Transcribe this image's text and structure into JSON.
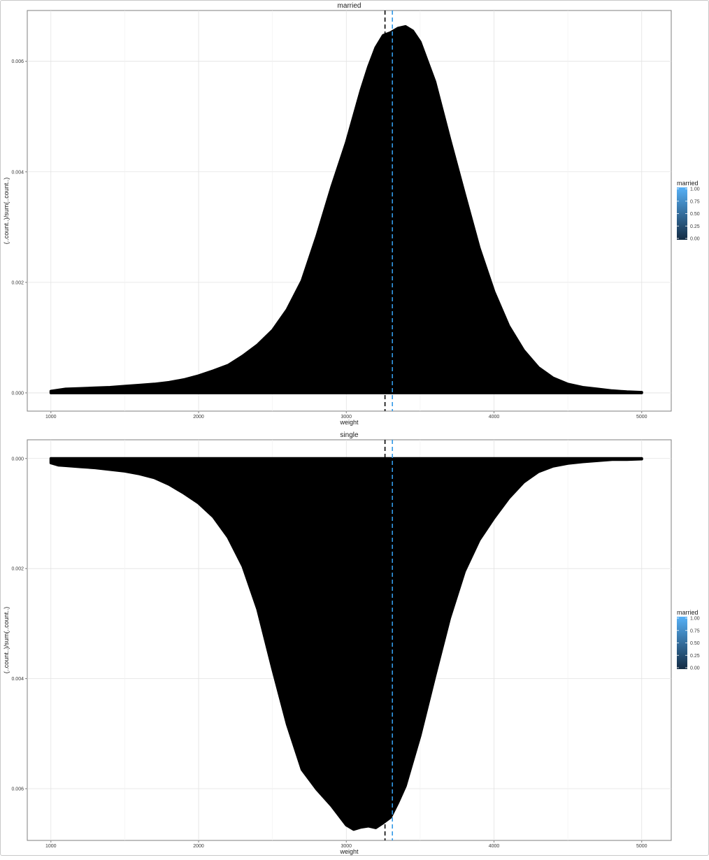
{
  "chart_data": [
    {
      "type": "area",
      "panel": "married",
      "title": "married",
      "xlabel": "weight",
      "ylabel": "(..count..)/sum(..count..)",
      "xlim": [
        840,
        5200
      ],
      "ylim": [
        -0.00033,
        0.00692
      ],
      "xticks": [
        1000,
        2000,
        3000,
        4000,
        5000
      ],
      "yticks": [
        0.0,
        0.002,
        0.004,
        0.006
      ],
      "ytick_labels": [
        "0.000",
        "0.002",
        "0.004",
        "0.006"
      ],
      "direction": "up",
      "x": [
        1000,
        1100,
        1200,
        1300,
        1400,
        1500,
        1600,
        1700,
        1800,
        1900,
        2000,
        2100,
        2200,
        2300,
        2400,
        2500,
        2600,
        2700,
        2800,
        2900,
        3000,
        3100,
        3150,
        3200,
        3250,
        3300,
        3350,
        3400,
        3450,
        3500,
        3600,
        3700,
        3800,
        3900,
        4000,
        4100,
        4200,
        4300,
        4400,
        4500,
        4600,
        4700,
        4800,
        4900,
        5000
      ],
      "y": [
        3e-05,
        7e-05,
        8e-05,
        9e-05,
        0.0001,
        0.00012,
        0.00014,
        0.00016,
        0.00019,
        0.00024,
        0.00031,
        0.0004,
        0.0005,
        0.00067,
        0.00087,
        0.00113,
        0.00151,
        0.00203,
        0.00283,
        0.00372,
        0.00453,
        0.00548,
        0.0059,
        0.00625,
        0.00647,
        0.00652,
        0.0066,
        0.00663,
        0.00655,
        0.00635,
        0.00563,
        0.0046,
        0.0036,
        0.00262,
        0.00183,
        0.00121,
        0.00077,
        0.00046,
        0.00027,
        0.00016,
        0.0001,
        7e-05,
        4e-05,
        2e-05,
        1e-05
      ],
      "vlines": [
        {
          "x": 3262,
          "color": "#000000",
          "linetype": "dashed"
        },
        {
          "x": 3312,
          "color": "#3399e6",
          "linetype": "dashed"
        }
      ],
      "fill": "#000000",
      "legend": {
        "title": "married",
        "position": "right",
        "labels": [
          "1.00",
          "0.75",
          "0.50",
          "0.25",
          "0.00"
        ],
        "low_color": "#132b43",
        "high_color": "#56b1f7"
      },
      "grid": true
    },
    {
      "type": "area",
      "panel": "single",
      "title": "single",
      "xlabel": "weight",
      "ylabel": "(..count..)/sum(..count..)",
      "xlim": [
        840,
        5200
      ],
      "ylim": [
        -0.00034,
        0.00694
      ],
      "xticks": [
        1000,
        2000,
        3000,
        4000,
        5000
      ],
      "yticks": [
        0.0,
        0.002,
        0.004,
        0.006
      ],
      "ytick_labels": [
        "0.000",
        "0.002",
        "0.004",
        "0.006"
      ],
      "direction": "down",
      "x": [
        1000,
        1050,
        1100,
        1200,
        1300,
        1400,
        1500,
        1600,
        1700,
        1800,
        1900,
        2000,
        2100,
        2200,
        2300,
        2400,
        2500,
        2600,
        2700,
        2800,
        2900,
        3000,
        3050,
        3100,
        3150,
        3200,
        3250,
        3300,
        3350,
        3400,
        3500,
        3600,
        3700,
        3800,
        3900,
        4000,
        4100,
        4200,
        4300,
        4400,
        4500,
        4600,
        4700,
        4800,
        4900,
        5000
      ],
      "y": [
        8e-05,
        0.00012,
        0.00013,
        0.00015,
        0.00017,
        0.0002,
        0.00023,
        0.00028,
        0.00035,
        0.00047,
        0.00063,
        0.00081,
        0.00106,
        0.00143,
        0.00196,
        0.00274,
        0.00381,
        0.00483,
        0.00565,
        0.00601,
        0.00631,
        0.00666,
        0.00674,
        0.0067,
        0.00668,
        0.00671,
        0.00662,
        0.00652,
        0.00625,
        0.00595,
        0.00503,
        0.00395,
        0.0029,
        0.00205,
        0.00148,
        0.00108,
        0.00072,
        0.00043,
        0.00024,
        0.00014,
        9e-05,
        6e-05,
        4e-05,
        2e-05,
        2e-05,
        1e-05
      ],
      "vlines": [
        {
          "x": 3262,
          "color": "#000000",
          "linetype": "dashed"
        },
        {
          "x": 3312,
          "color": "#3399e6",
          "linetype": "dashed"
        }
      ],
      "fill": "#000000",
      "legend": {
        "title": "married",
        "position": "right",
        "labels": [
          "1.00",
          "0.75",
          "0.50",
          "0.25",
          "0.00"
        ],
        "low_color": "#132b43",
        "high_color": "#56b1f7"
      },
      "grid": true
    }
  ]
}
